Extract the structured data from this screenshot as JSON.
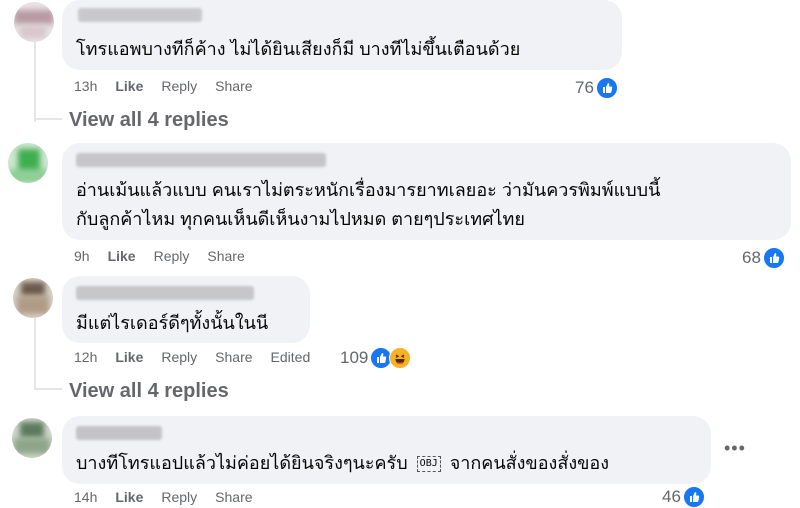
{
  "comments": [
    {
      "text": "โทรแอพบางทีก็ค้าง ไม่ได้ยินเสียงก็มี บางทีไม่ขึ้นเตือนด้วย",
      "time": "13h",
      "like": "Like",
      "reply": "Reply",
      "share": "Share",
      "reactions": "76"
    },
    {
      "text_line1": "อ่านเม้นแล้วแบบ คนเราไม่ตระหนักเรื่องมารยาทเลยอะ ว่ามันควรพิมพ์แบบนี้",
      "text_line2": "กับลูกค้าไหม ทุกคนเห็นดีเห็นงามไปหมด ตายๆประเทศไทย",
      "time": "9h",
      "like": "Like",
      "reply": "Reply",
      "share": "Share",
      "reactions": "68"
    },
    {
      "text": "มีแต่ไรเดอร์ดีๆทั้งนั้นในนี",
      "time": "12h",
      "like": "Like",
      "reply": "Reply",
      "share": "Share",
      "edited": "Edited",
      "reactions": "109"
    },
    {
      "text_before": "บางทีโทรแอปแล้วไม่ค่อยได้ยินจริงๆนะครับ",
      "obj_glyph": "OBJ",
      "text_after": "จากคนสั่งของสั่งของ",
      "time": "14h",
      "like": "Like",
      "reply": "Reply",
      "share": "Share",
      "reactions": "46"
    }
  ],
  "view_replies_1": "View all 4 replies",
  "view_replies_2": "View all 4 replies",
  "colors": {
    "like_blue": "#1877f2",
    "bubble": "#f0f2f5",
    "meta": "#65676b",
    "haha_yellow": "#f7b125"
  },
  "icons": {
    "like": "thumbs-up-icon",
    "haha": "haha-emoji-icon",
    "more": "more-options-icon"
  }
}
